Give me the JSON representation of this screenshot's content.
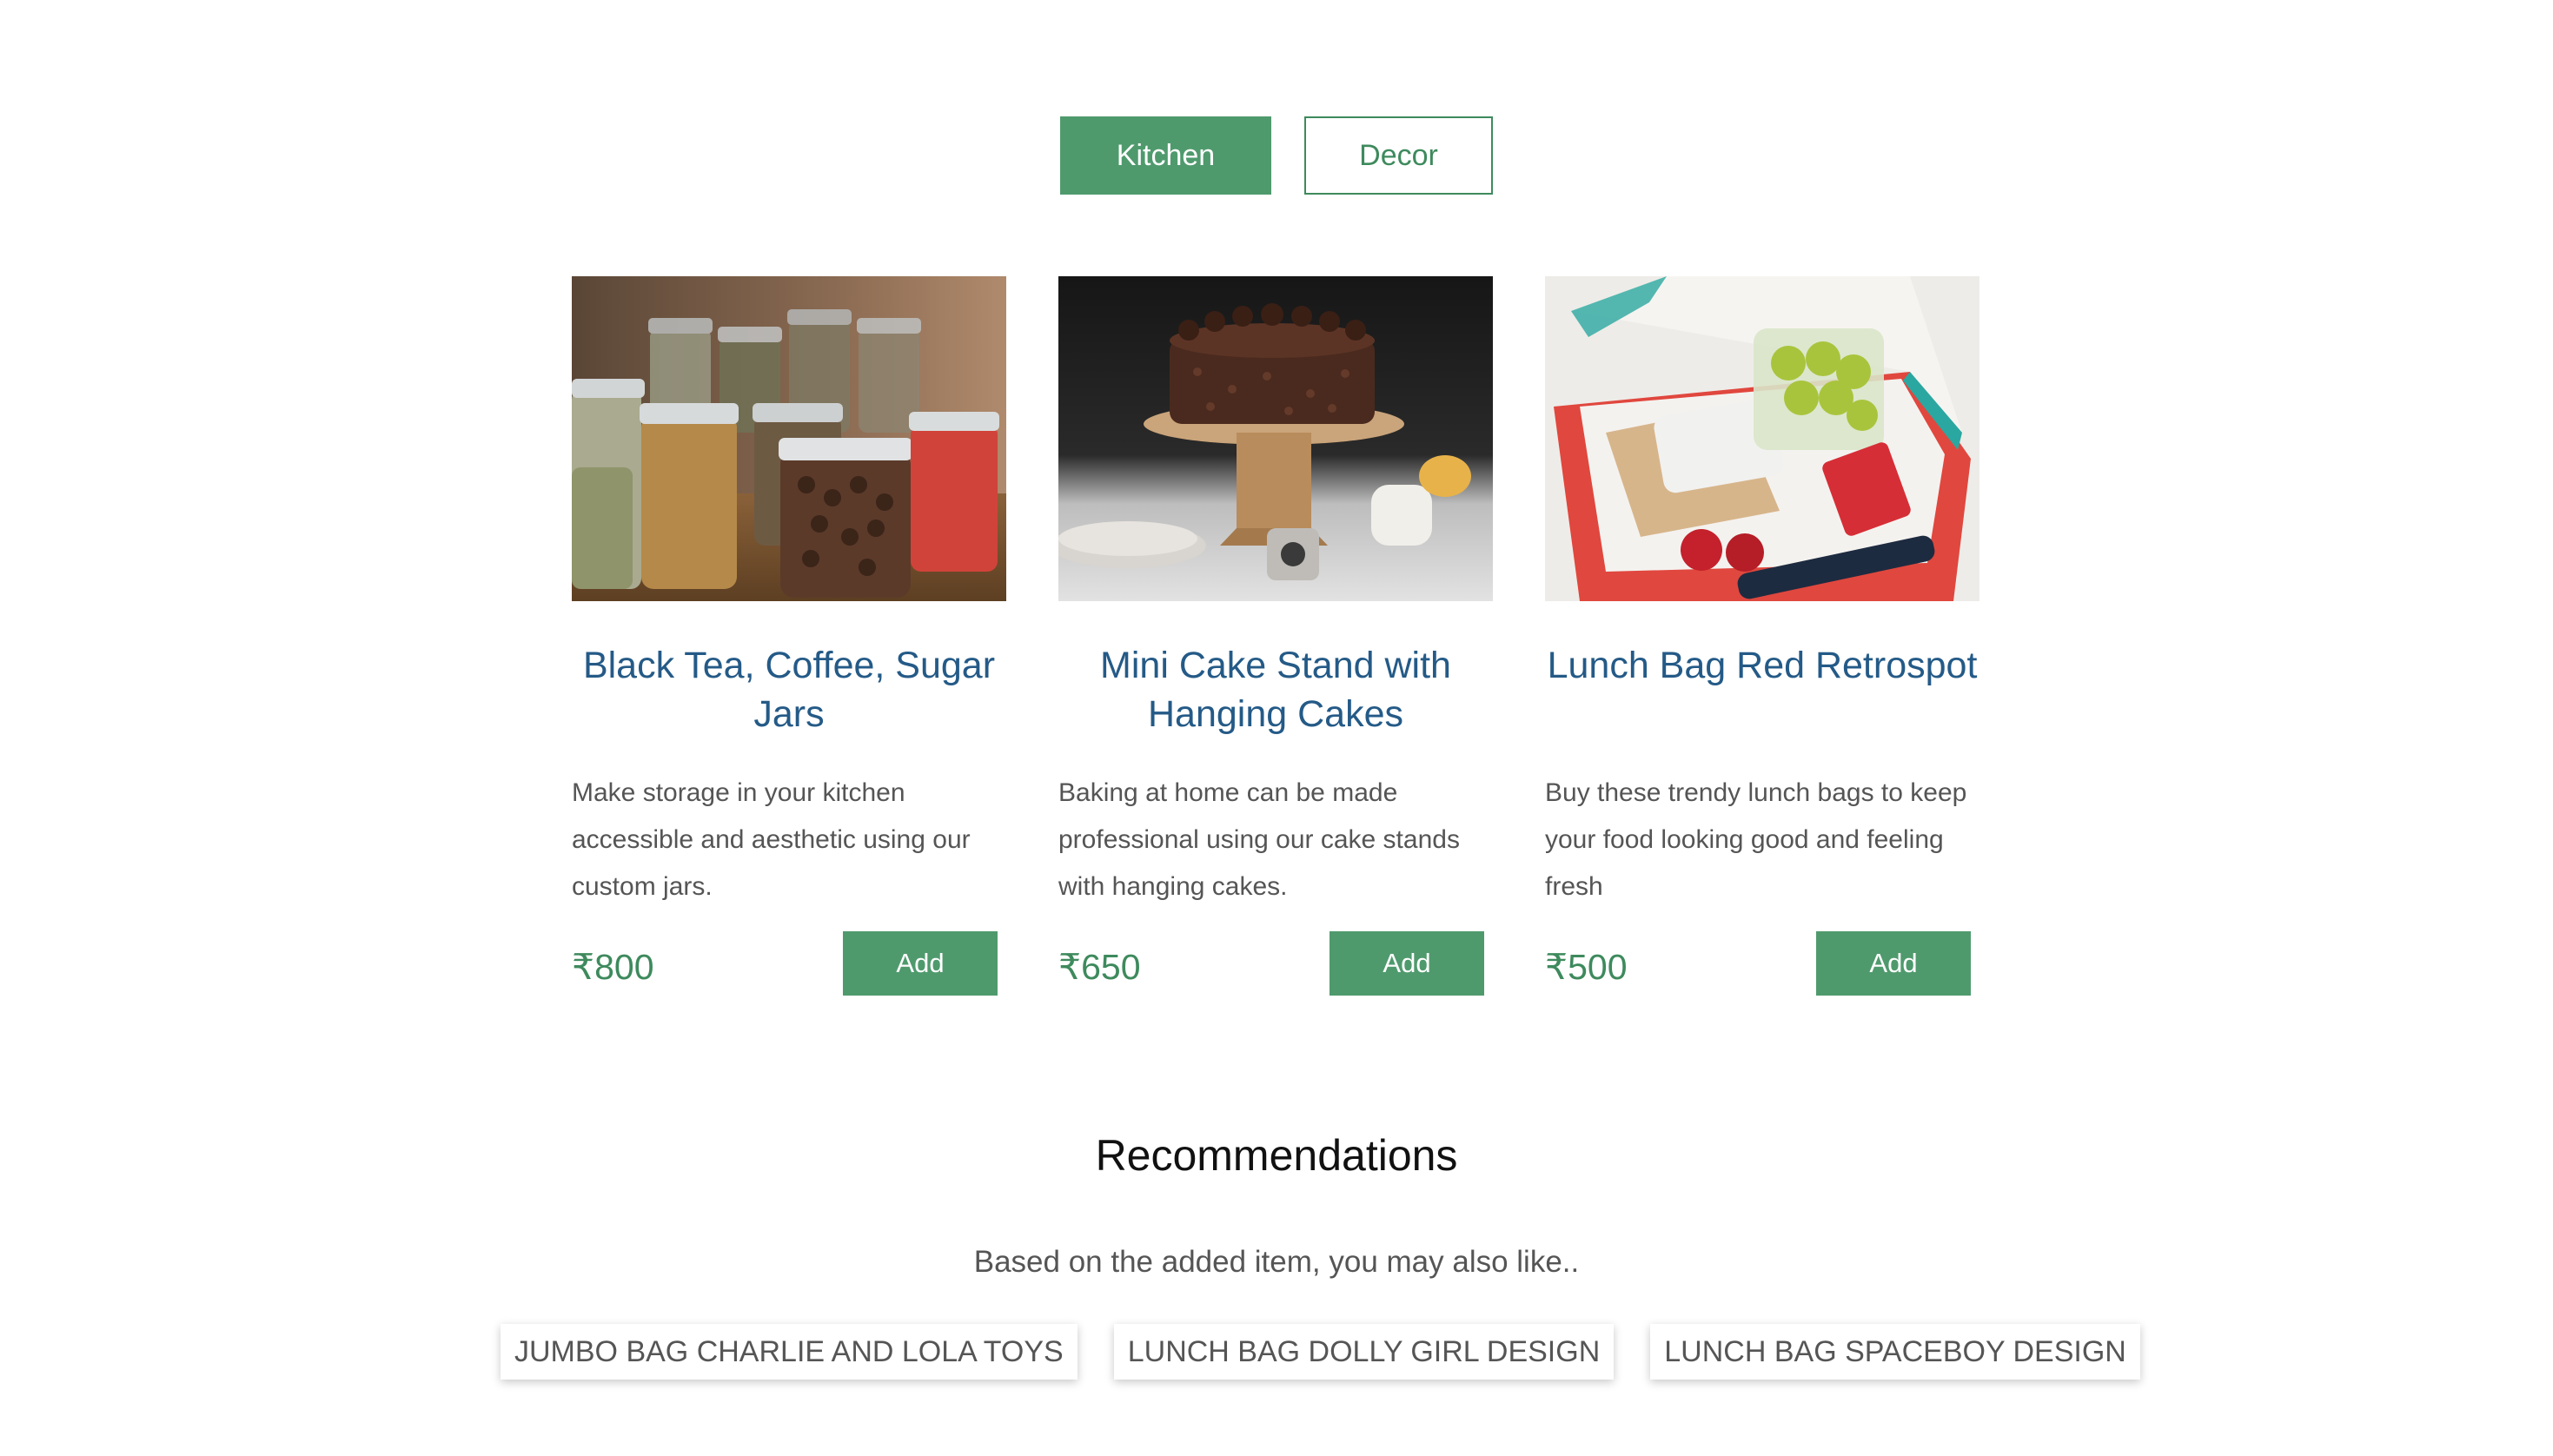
{
  "tabs": [
    {
      "label": "Kitchen",
      "active": true
    },
    {
      "label": "Decor",
      "active": false
    }
  ],
  "products": [
    {
      "title": "Black Tea, Coffee, Sugar Jars",
      "description": "Make storage in your kitchen accessible and aesthetic using our custom jars.",
      "price": "₹800",
      "add_label": "Add",
      "image": "spice-jars-photo"
    },
    {
      "title": "Mini Cake Stand with Hanging Cakes",
      "description": "Baking at home can be made professional using our cake stands with hanging cakes.",
      "price": "₹650",
      "add_label": "Add",
      "image": "chocolate-cake-stand-photo"
    },
    {
      "title": "Lunch Bag Red Retrospot",
      "description": "Buy these trendy lunch bags to keep your food looking good and feeling fresh",
      "price": "₹500",
      "add_label": "Add",
      "image": "red-lunch-bag-photo"
    }
  ],
  "recommendations": {
    "title": "Recommendations",
    "subtitle": "Based on the added item, you may also like..",
    "items": [
      "JUMBO BAG CHARLIE AND LOLA TOYS",
      "LUNCH BAG DOLLY GIRL DESIGN",
      "LUNCH BAG SPACEBOY DESIGN"
    ]
  },
  "colors": {
    "accent_green": "#4f9a6d",
    "title_blue": "#245a87",
    "price_green": "#3e8a5d"
  }
}
